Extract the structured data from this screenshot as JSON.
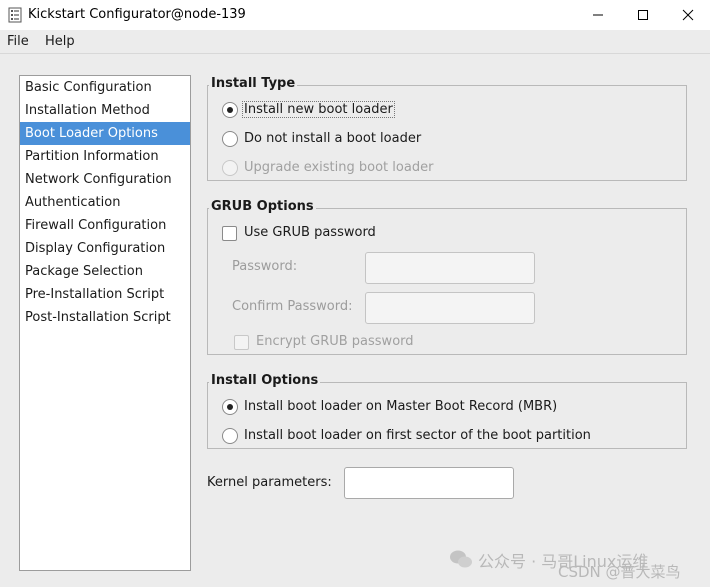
{
  "window": {
    "title": "Kickstart Configurator@node-139"
  },
  "menu": {
    "file": "File",
    "help": "Help"
  },
  "sidebar": {
    "items": [
      {
        "label": "Basic Configuration"
      },
      {
        "label": "Installation Method"
      },
      {
        "label": "Boot Loader Options",
        "selected": true
      },
      {
        "label": "Partition Information"
      },
      {
        "label": "Network Configuration"
      },
      {
        "label": "Authentication"
      },
      {
        "label": "Firewall Configuration"
      },
      {
        "label": "Display Configuration"
      },
      {
        "label": "Package Selection"
      },
      {
        "label": "Pre-Installation Script"
      },
      {
        "label": "Post-Installation Script"
      }
    ]
  },
  "install_type": {
    "title": "Install Type",
    "options": [
      {
        "label": "Install new boot loader",
        "selected": true
      },
      {
        "label": "Do not install a boot loader",
        "selected": false
      },
      {
        "label": "Upgrade existing boot loader",
        "selected": false,
        "disabled": true
      }
    ]
  },
  "grub": {
    "title": "GRUB Options",
    "use_password_label": "Use GRUB password",
    "use_password_checked": false,
    "password_label": "Password:",
    "password_value": "",
    "confirm_label": "Confirm Password:",
    "confirm_value": "",
    "encrypt_label": "Encrypt GRUB password",
    "encrypt_checked": false
  },
  "install_options": {
    "title": "Install Options",
    "options": [
      {
        "label": "Install boot loader on Master Boot Record (MBR)",
        "selected": true
      },
      {
        "label": "Install boot loader on first sector of the boot partition",
        "selected": false
      }
    ]
  },
  "kernel": {
    "label": "Kernel parameters:",
    "value": ""
  },
  "watermark": {
    "line1": "公众号 · 马哥Linux运维",
    "line2": "CSDN @普大菜鸟"
  }
}
